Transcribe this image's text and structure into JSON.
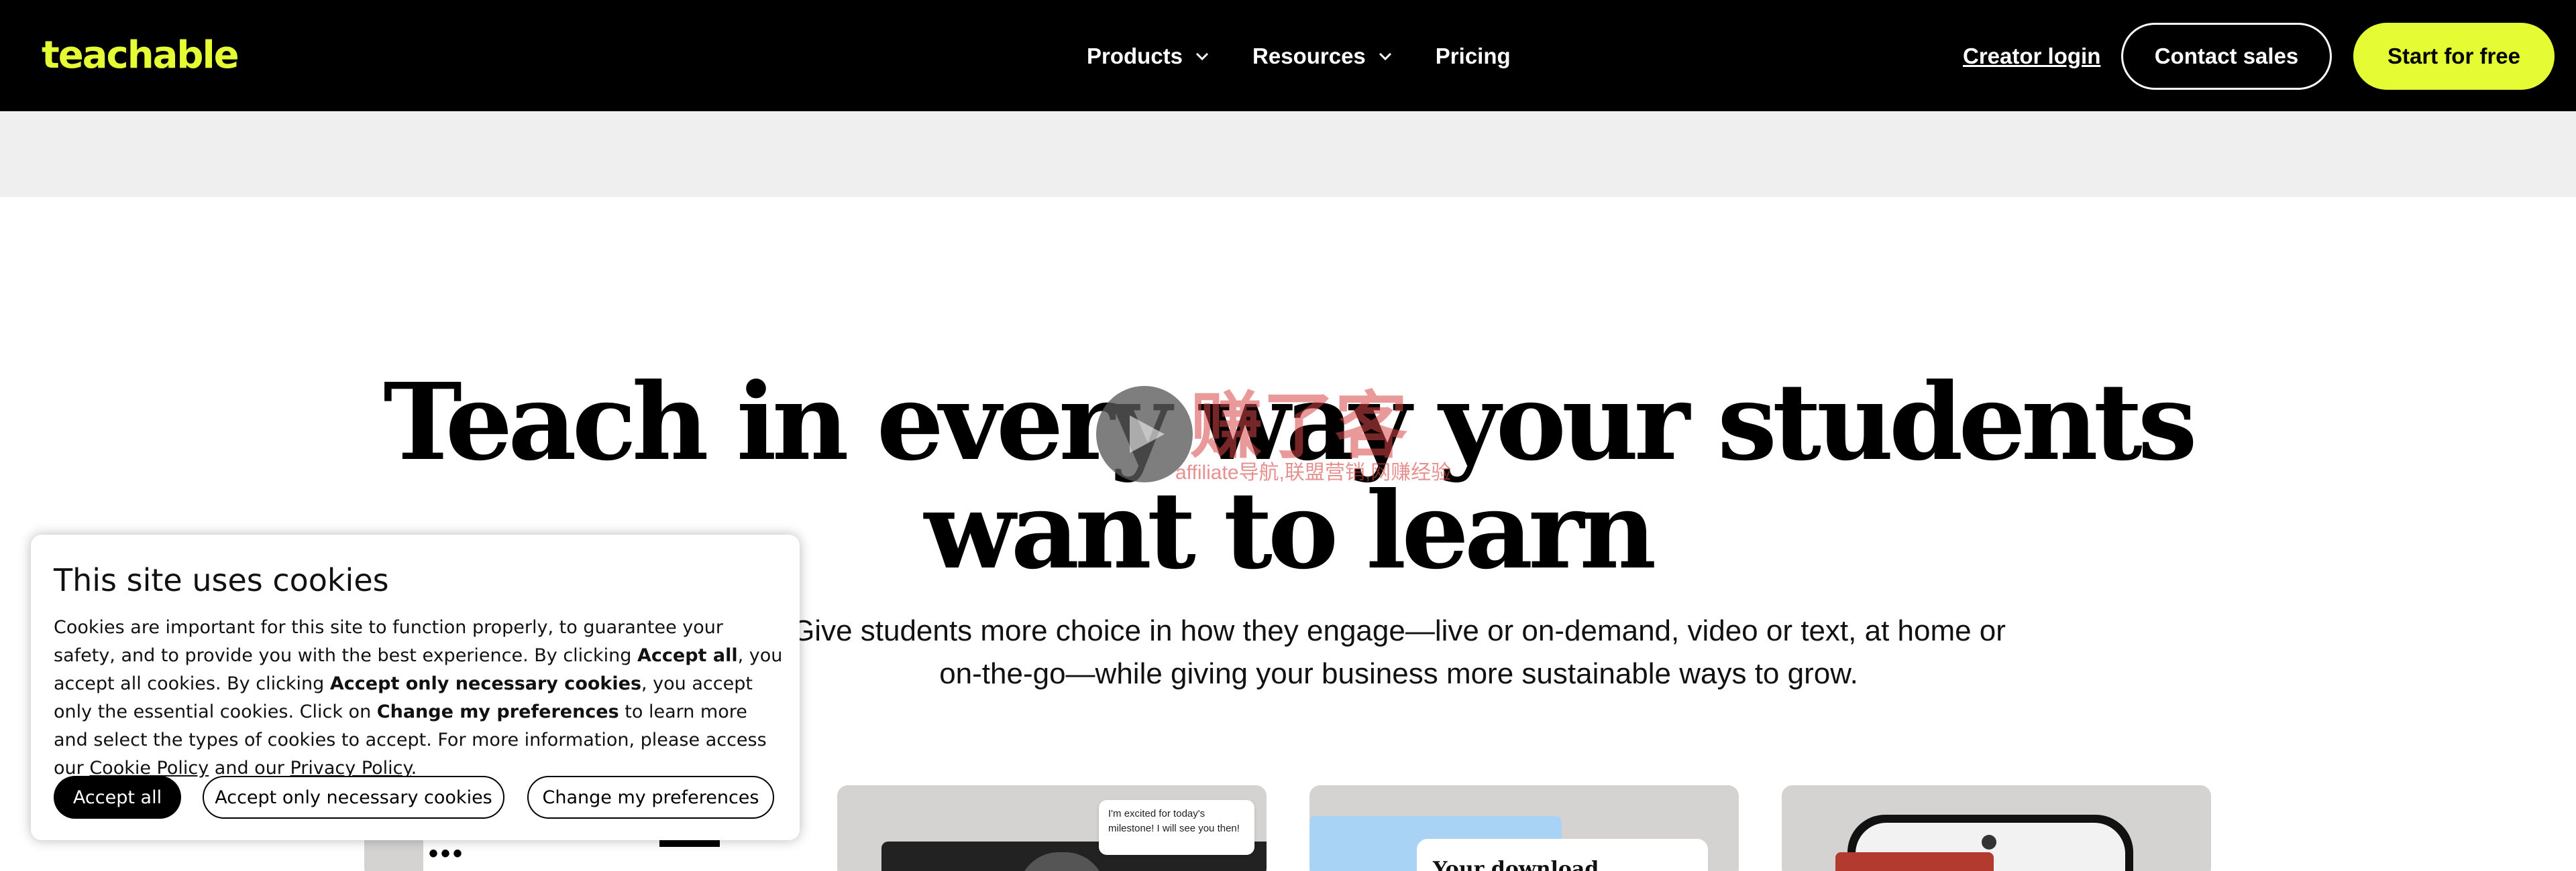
{
  "header": {
    "logo": "teachable",
    "nav": [
      {
        "label": "Products",
        "icon": "chevron-down-icon"
      },
      {
        "label": "Resources",
        "icon": "chevron-down-icon"
      },
      {
        "label": "Pricing"
      }
    ],
    "creator_login": "Creator login",
    "contact_sales": "Contact sales",
    "start_for_free": "Start for free"
  },
  "hero": {
    "title_line1": "Teach in every way your students",
    "title_line2": "want to learn",
    "subtitle": "Give students more choice in how they engage—live or on-demand, video or text, at home or on-the-go—while giving your business more sustainable ways to grow."
  },
  "watermark": {
    "main": "赚了客",
    "sub": "affiliate导航,联盟营销,网赚经验"
  },
  "cards": {
    "chat_bubble": "I'm excited for today's milestone! I will see you then!",
    "download_title": "Your download"
  },
  "cookie_banner": {
    "title": "This site uses cookies",
    "body": {
      "t1": "Cookies are important for this site to function properly, to guarantee your safety, and to provide you with the best experience. By clicking ",
      "b1": "Accept all",
      "t2": ", you accept all cookies. By clicking ",
      "b2": "Accept only necessary cookies",
      "t3": ", you accept only the essential cookies. Click on ",
      "b3": "Change my preferences",
      "t4": " to learn more and select the types of cookies to accept. For more information, please access our ",
      "cookie_policy": "Cookie Policy",
      "t5": " and our ",
      "privacy_policy": "Privacy Policy",
      "t6": "."
    },
    "accept_all": "Accept all",
    "accept_necessary": "Accept only necessary cookies",
    "change_preferences": "Change my preferences"
  },
  "colors": {
    "nav_background": "#000000",
    "brand_accent": "#e5fb34",
    "section_gray": "#efefef"
  }
}
